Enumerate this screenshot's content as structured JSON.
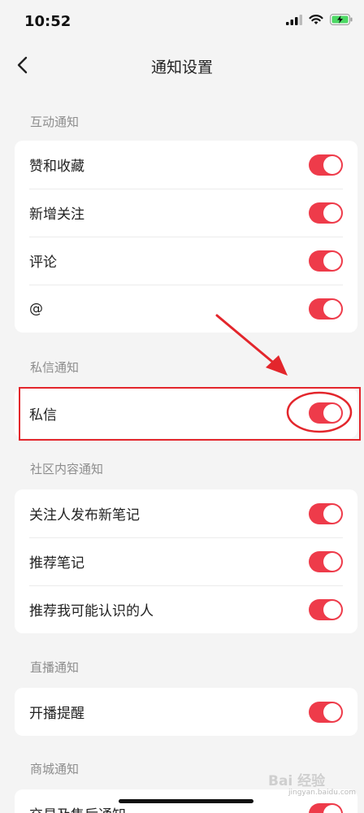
{
  "status_bar": {
    "time": "10:52"
  },
  "nav": {
    "title": "通知设置"
  },
  "sections": {
    "interaction": {
      "title": "互动通知",
      "items": [
        {
          "label": "赞和收藏",
          "enabled": true
        },
        {
          "label": "新增关注",
          "enabled": true
        },
        {
          "label": "评论",
          "enabled": true
        },
        {
          "label": "@",
          "enabled": true
        }
      ]
    },
    "private_message": {
      "title": "私信通知",
      "items": [
        {
          "label": "私信",
          "enabled": true
        }
      ]
    },
    "community": {
      "title": "社区内容通知",
      "items": [
        {
          "label": "关注人发布新笔记",
          "enabled": true
        },
        {
          "label": "推荐笔记",
          "enabled": true
        },
        {
          "label": "推荐我可能认识的人",
          "enabled": true
        }
      ]
    },
    "live": {
      "title": "直播通知",
      "items": [
        {
          "label": "开播提醒",
          "enabled": true
        }
      ]
    },
    "mall": {
      "title": "商城通知",
      "items": [
        {
          "label": "交易及售后通知",
          "enabled": true
        }
      ]
    }
  },
  "watermark": {
    "text": "Bai 经验",
    "sub": "jingyan.baidu.com"
  },
  "colors": {
    "accent": "#ee3b4a",
    "annotation": "#e3262c",
    "background": "#f4f4f4"
  }
}
